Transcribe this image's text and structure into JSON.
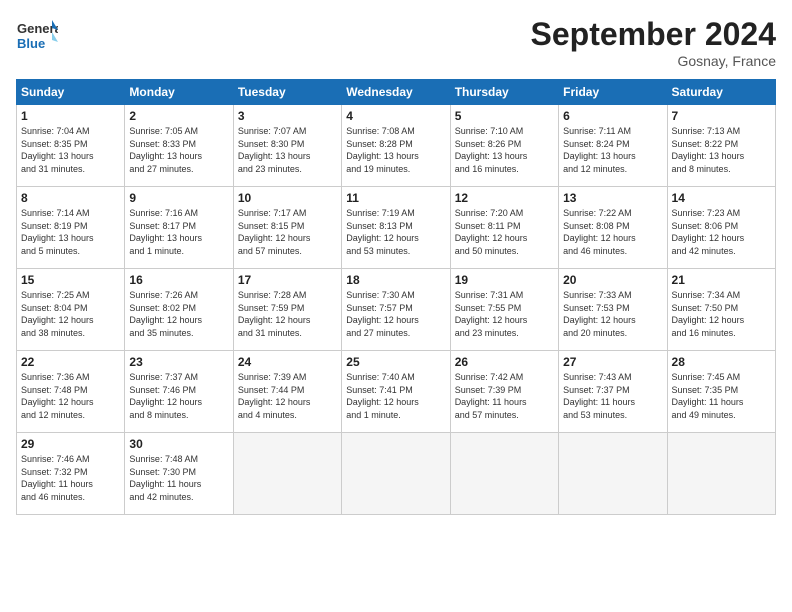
{
  "header": {
    "logo_line1": "General",
    "logo_line2": "Blue",
    "month_title": "September 2024",
    "subtitle": "Gosnay, France"
  },
  "weekdays": [
    "Sunday",
    "Monday",
    "Tuesday",
    "Wednesday",
    "Thursday",
    "Friday",
    "Saturday"
  ],
  "weeks": [
    [
      {
        "day": "1",
        "info": "Sunrise: 7:04 AM\nSunset: 8:35 PM\nDaylight: 13 hours\nand 31 minutes."
      },
      {
        "day": "2",
        "info": "Sunrise: 7:05 AM\nSunset: 8:33 PM\nDaylight: 13 hours\nand 27 minutes."
      },
      {
        "day": "3",
        "info": "Sunrise: 7:07 AM\nSunset: 8:30 PM\nDaylight: 13 hours\nand 23 minutes."
      },
      {
        "day": "4",
        "info": "Sunrise: 7:08 AM\nSunset: 8:28 PM\nDaylight: 13 hours\nand 19 minutes."
      },
      {
        "day": "5",
        "info": "Sunrise: 7:10 AM\nSunset: 8:26 PM\nDaylight: 13 hours\nand 16 minutes."
      },
      {
        "day": "6",
        "info": "Sunrise: 7:11 AM\nSunset: 8:24 PM\nDaylight: 13 hours\nand 12 minutes."
      },
      {
        "day": "7",
        "info": "Sunrise: 7:13 AM\nSunset: 8:22 PM\nDaylight: 13 hours\nand 8 minutes."
      }
    ],
    [
      {
        "day": "8",
        "info": "Sunrise: 7:14 AM\nSunset: 8:19 PM\nDaylight: 13 hours\nand 5 minutes."
      },
      {
        "day": "9",
        "info": "Sunrise: 7:16 AM\nSunset: 8:17 PM\nDaylight: 13 hours\nand 1 minute."
      },
      {
        "day": "10",
        "info": "Sunrise: 7:17 AM\nSunset: 8:15 PM\nDaylight: 12 hours\nand 57 minutes."
      },
      {
        "day": "11",
        "info": "Sunrise: 7:19 AM\nSunset: 8:13 PM\nDaylight: 12 hours\nand 53 minutes."
      },
      {
        "day": "12",
        "info": "Sunrise: 7:20 AM\nSunset: 8:11 PM\nDaylight: 12 hours\nand 50 minutes."
      },
      {
        "day": "13",
        "info": "Sunrise: 7:22 AM\nSunset: 8:08 PM\nDaylight: 12 hours\nand 46 minutes."
      },
      {
        "day": "14",
        "info": "Sunrise: 7:23 AM\nSunset: 8:06 PM\nDaylight: 12 hours\nand 42 minutes."
      }
    ],
    [
      {
        "day": "15",
        "info": "Sunrise: 7:25 AM\nSunset: 8:04 PM\nDaylight: 12 hours\nand 38 minutes."
      },
      {
        "day": "16",
        "info": "Sunrise: 7:26 AM\nSunset: 8:02 PM\nDaylight: 12 hours\nand 35 minutes."
      },
      {
        "day": "17",
        "info": "Sunrise: 7:28 AM\nSunset: 7:59 PM\nDaylight: 12 hours\nand 31 minutes."
      },
      {
        "day": "18",
        "info": "Sunrise: 7:30 AM\nSunset: 7:57 PM\nDaylight: 12 hours\nand 27 minutes."
      },
      {
        "day": "19",
        "info": "Sunrise: 7:31 AM\nSunset: 7:55 PM\nDaylight: 12 hours\nand 23 minutes."
      },
      {
        "day": "20",
        "info": "Sunrise: 7:33 AM\nSunset: 7:53 PM\nDaylight: 12 hours\nand 20 minutes."
      },
      {
        "day": "21",
        "info": "Sunrise: 7:34 AM\nSunset: 7:50 PM\nDaylight: 12 hours\nand 16 minutes."
      }
    ],
    [
      {
        "day": "22",
        "info": "Sunrise: 7:36 AM\nSunset: 7:48 PM\nDaylight: 12 hours\nand 12 minutes."
      },
      {
        "day": "23",
        "info": "Sunrise: 7:37 AM\nSunset: 7:46 PM\nDaylight: 12 hours\nand 8 minutes."
      },
      {
        "day": "24",
        "info": "Sunrise: 7:39 AM\nSunset: 7:44 PM\nDaylight: 12 hours\nand 4 minutes."
      },
      {
        "day": "25",
        "info": "Sunrise: 7:40 AM\nSunset: 7:41 PM\nDaylight: 12 hours\nand 1 minute."
      },
      {
        "day": "26",
        "info": "Sunrise: 7:42 AM\nSunset: 7:39 PM\nDaylight: 11 hours\nand 57 minutes."
      },
      {
        "day": "27",
        "info": "Sunrise: 7:43 AM\nSunset: 7:37 PM\nDaylight: 11 hours\nand 53 minutes."
      },
      {
        "day": "28",
        "info": "Sunrise: 7:45 AM\nSunset: 7:35 PM\nDaylight: 11 hours\nand 49 minutes."
      }
    ],
    [
      {
        "day": "29",
        "info": "Sunrise: 7:46 AM\nSunset: 7:32 PM\nDaylight: 11 hours\nand 46 minutes."
      },
      {
        "day": "30",
        "info": "Sunrise: 7:48 AM\nSunset: 7:30 PM\nDaylight: 11 hours\nand 42 minutes."
      },
      {
        "day": "",
        "info": ""
      },
      {
        "day": "",
        "info": ""
      },
      {
        "day": "",
        "info": ""
      },
      {
        "day": "",
        "info": ""
      },
      {
        "day": "",
        "info": ""
      }
    ]
  ]
}
